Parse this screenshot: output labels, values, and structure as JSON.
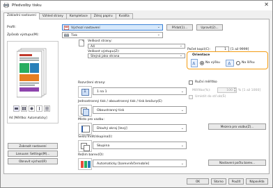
{
  "window": {
    "title": "Předvolby tisku",
    "close_glyph": "✕"
  },
  "tabs": [
    {
      "label": "Základní nastavení",
      "active": true
    },
    {
      "label": "Vzhled strany"
    },
    {
      "label": "Kompletace"
    },
    {
      "label": "Zdroj papíru"
    },
    {
      "label": "Kvalita"
    }
  ],
  "profile": {
    "label": "Profil:",
    "value": "Výchozí nastavení",
    "add_label": "Přidat(1)...",
    "edit_label": "Upravit(2)..."
  },
  "output_method": {
    "label": "Způsob výstupu(M):",
    "value": "Tisk"
  },
  "preview": {
    "caption": "A4 [Měřítko: Automaticky]"
  },
  "left_buttons": {
    "restore": "Obnovit výchozí(R)",
    "license": "Lanuuse: Settings(M)...",
    "defaults": "Zobrazit nastavení"
  },
  "page_size": {
    "label": "Velikost strany:",
    "value": "A4"
  },
  "output_size": {
    "label": "Velikost výstupu(Z):",
    "value": "Stejná jako strana"
  },
  "copies": {
    "label": "Počet kopií(C):",
    "value": "1",
    "range": "[1 až 9999]"
  },
  "orientation": {
    "label": "Orientace",
    "portrait": "Na výšku",
    "landscape": "Na šířku",
    "selected": "portrait"
  },
  "layout": {
    "label": "Rozvržení strany:",
    "value": "1 na 1"
  },
  "manual_scaling": {
    "label": "Ruční měřítko",
    "scale_label": "Měřítko(%):",
    "scale_value": "100",
    "scale_range": "% [1 až 1000]",
    "secondary_label": "Umístit do stř.ob(Š)"
  },
  "duplex": {
    "label": "Jednostranný tisk / oboustranný tisk / tisk brožury(E)",
    "value": "Oboustranný tisk"
  },
  "binding": {
    "label": "Místo pro vazbu:",
    "value": "Dlouhý okraj [levý]",
    "button": "Mezera pro vazbu(Z)..."
  },
  "collate": {
    "label": "Sešít/Třídit/skupina(I):",
    "value": "Skupina"
  },
  "color_mode": {
    "label": "Režim barev(O):",
    "value": "Automaticky [barevně/černobíle]",
    "button": "Nastavení počtu barev..."
  },
  "footer": {
    "ok": "OK",
    "cancel": "Storno",
    "apply": "Použít",
    "help": "Nápověda"
  }
}
